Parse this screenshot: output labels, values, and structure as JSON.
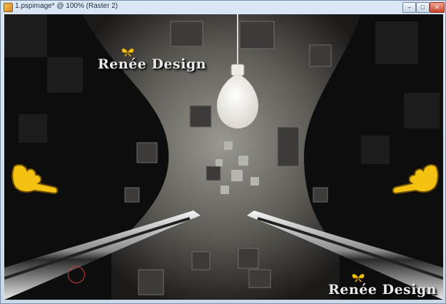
{
  "window": {
    "title": "1.pspimage* @ 100% (Raster 2)",
    "app_icon": "psp-app-icon",
    "controls": {
      "minimize": "–",
      "maximize": "□",
      "close": "✕"
    }
  },
  "canvas": {
    "watermark_top": "Renée Design",
    "watermark_bottom": "Renée Design",
    "icons": [
      "butterfly-icon",
      "pointing-hand-icon",
      "lightbulb-icon",
      "brush-cursor-icon"
    ],
    "colors": {
      "background": "#0d0d0d",
      "panel": "#8c8884",
      "bulb": "#f5f3ee",
      "hand": "#f3c210",
      "cursor": "#c43a3a"
    }
  }
}
